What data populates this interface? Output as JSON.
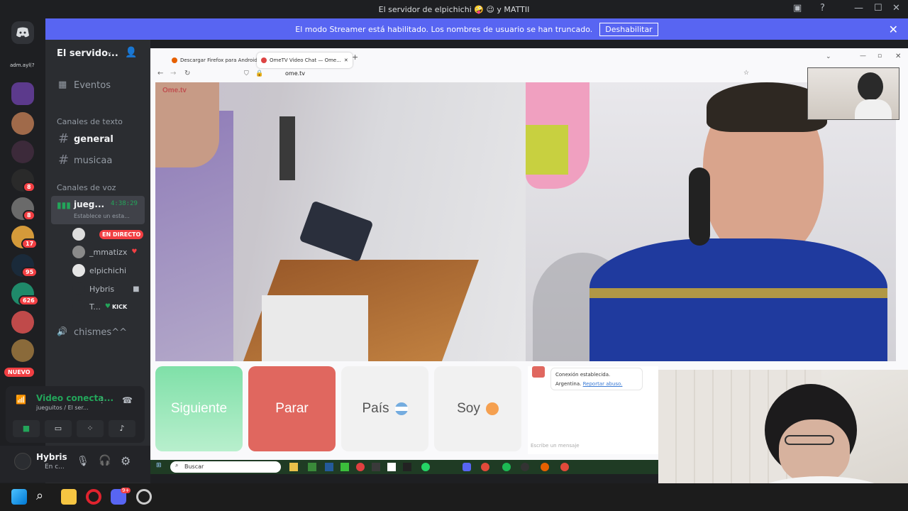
{
  "window": {
    "title": "El servidor de elpichichi 🤪 😉 y MATTII",
    "min": "—",
    "max": "☐",
    "close": "✕"
  },
  "banner": {
    "text": "El modo Streamer está habilitado. Los nombres de usuario se han truncado.",
    "button": "Deshabilitar"
  },
  "rail": {
    "top_label": "adm.ayl(?",
    "badges": [
      "8",
      "8",
      "17",
      "95",
      "626"
    ],
    "new_label": "NUEVO"
  },
  "sidebar": {
    "server_name": "El servido...",
    "events": "Eventos",
    "text_category": "Canales de texto",
    "text_channels": [
      "general",
      "musicaa"
    ],
    "voice_category": "Canales de voz",
    "voice_channel": {
      "name": "jueg...",
      "timer": "4:38:29",
      "status": "Establece un esta..."
    },
    "live_badge": "EN DIRECTO",
    "voice_users": [
      "_mmatizx",
      "elpichichi",
      "Hybris",
      "T..."
    ],
    "kick_label": "KICK",
    "other_channel": "chismes^^"
  },
  "voice_panel": {
    "status": "Video conecta...",
    "sub": "jueguitos / El ser..."
  },
  "user_panel": {
    "name": "Hybris",
    "status": "En c..."
  },
  "browser": {
    "tabs": [
      "Descargar Firefox para Android",
      "OmeTV Video Chat — Ome..."
    ],
    "url": "ome.tv",
    "logo": "Ome.tv"
  },
  "ometv": {
    "next": "Siguiente",
    "stop": "Parar",
    "country": "País",
    "me": "Soy",
    "chat_status": "Conexión establecida.",
    "chat_country": "Argentina.",
    "chat_report": "Reportar abuso.",
    "chat_placeholder": "Escribe un mensaje"
  },
  "win_taskbar": {
    "search_placeholder": "Buscar"
  },
  "taskbar": {
    "discord_badge": "9+"
  },
  "colors": {
    "blurple": "#5865f2",
    "next_green": "#7fe0a8",
    "stop_red": "#e0675f",
    "live_red": "#f23f43",
    "boca_blue": "#1f3a9e"
  }
}
